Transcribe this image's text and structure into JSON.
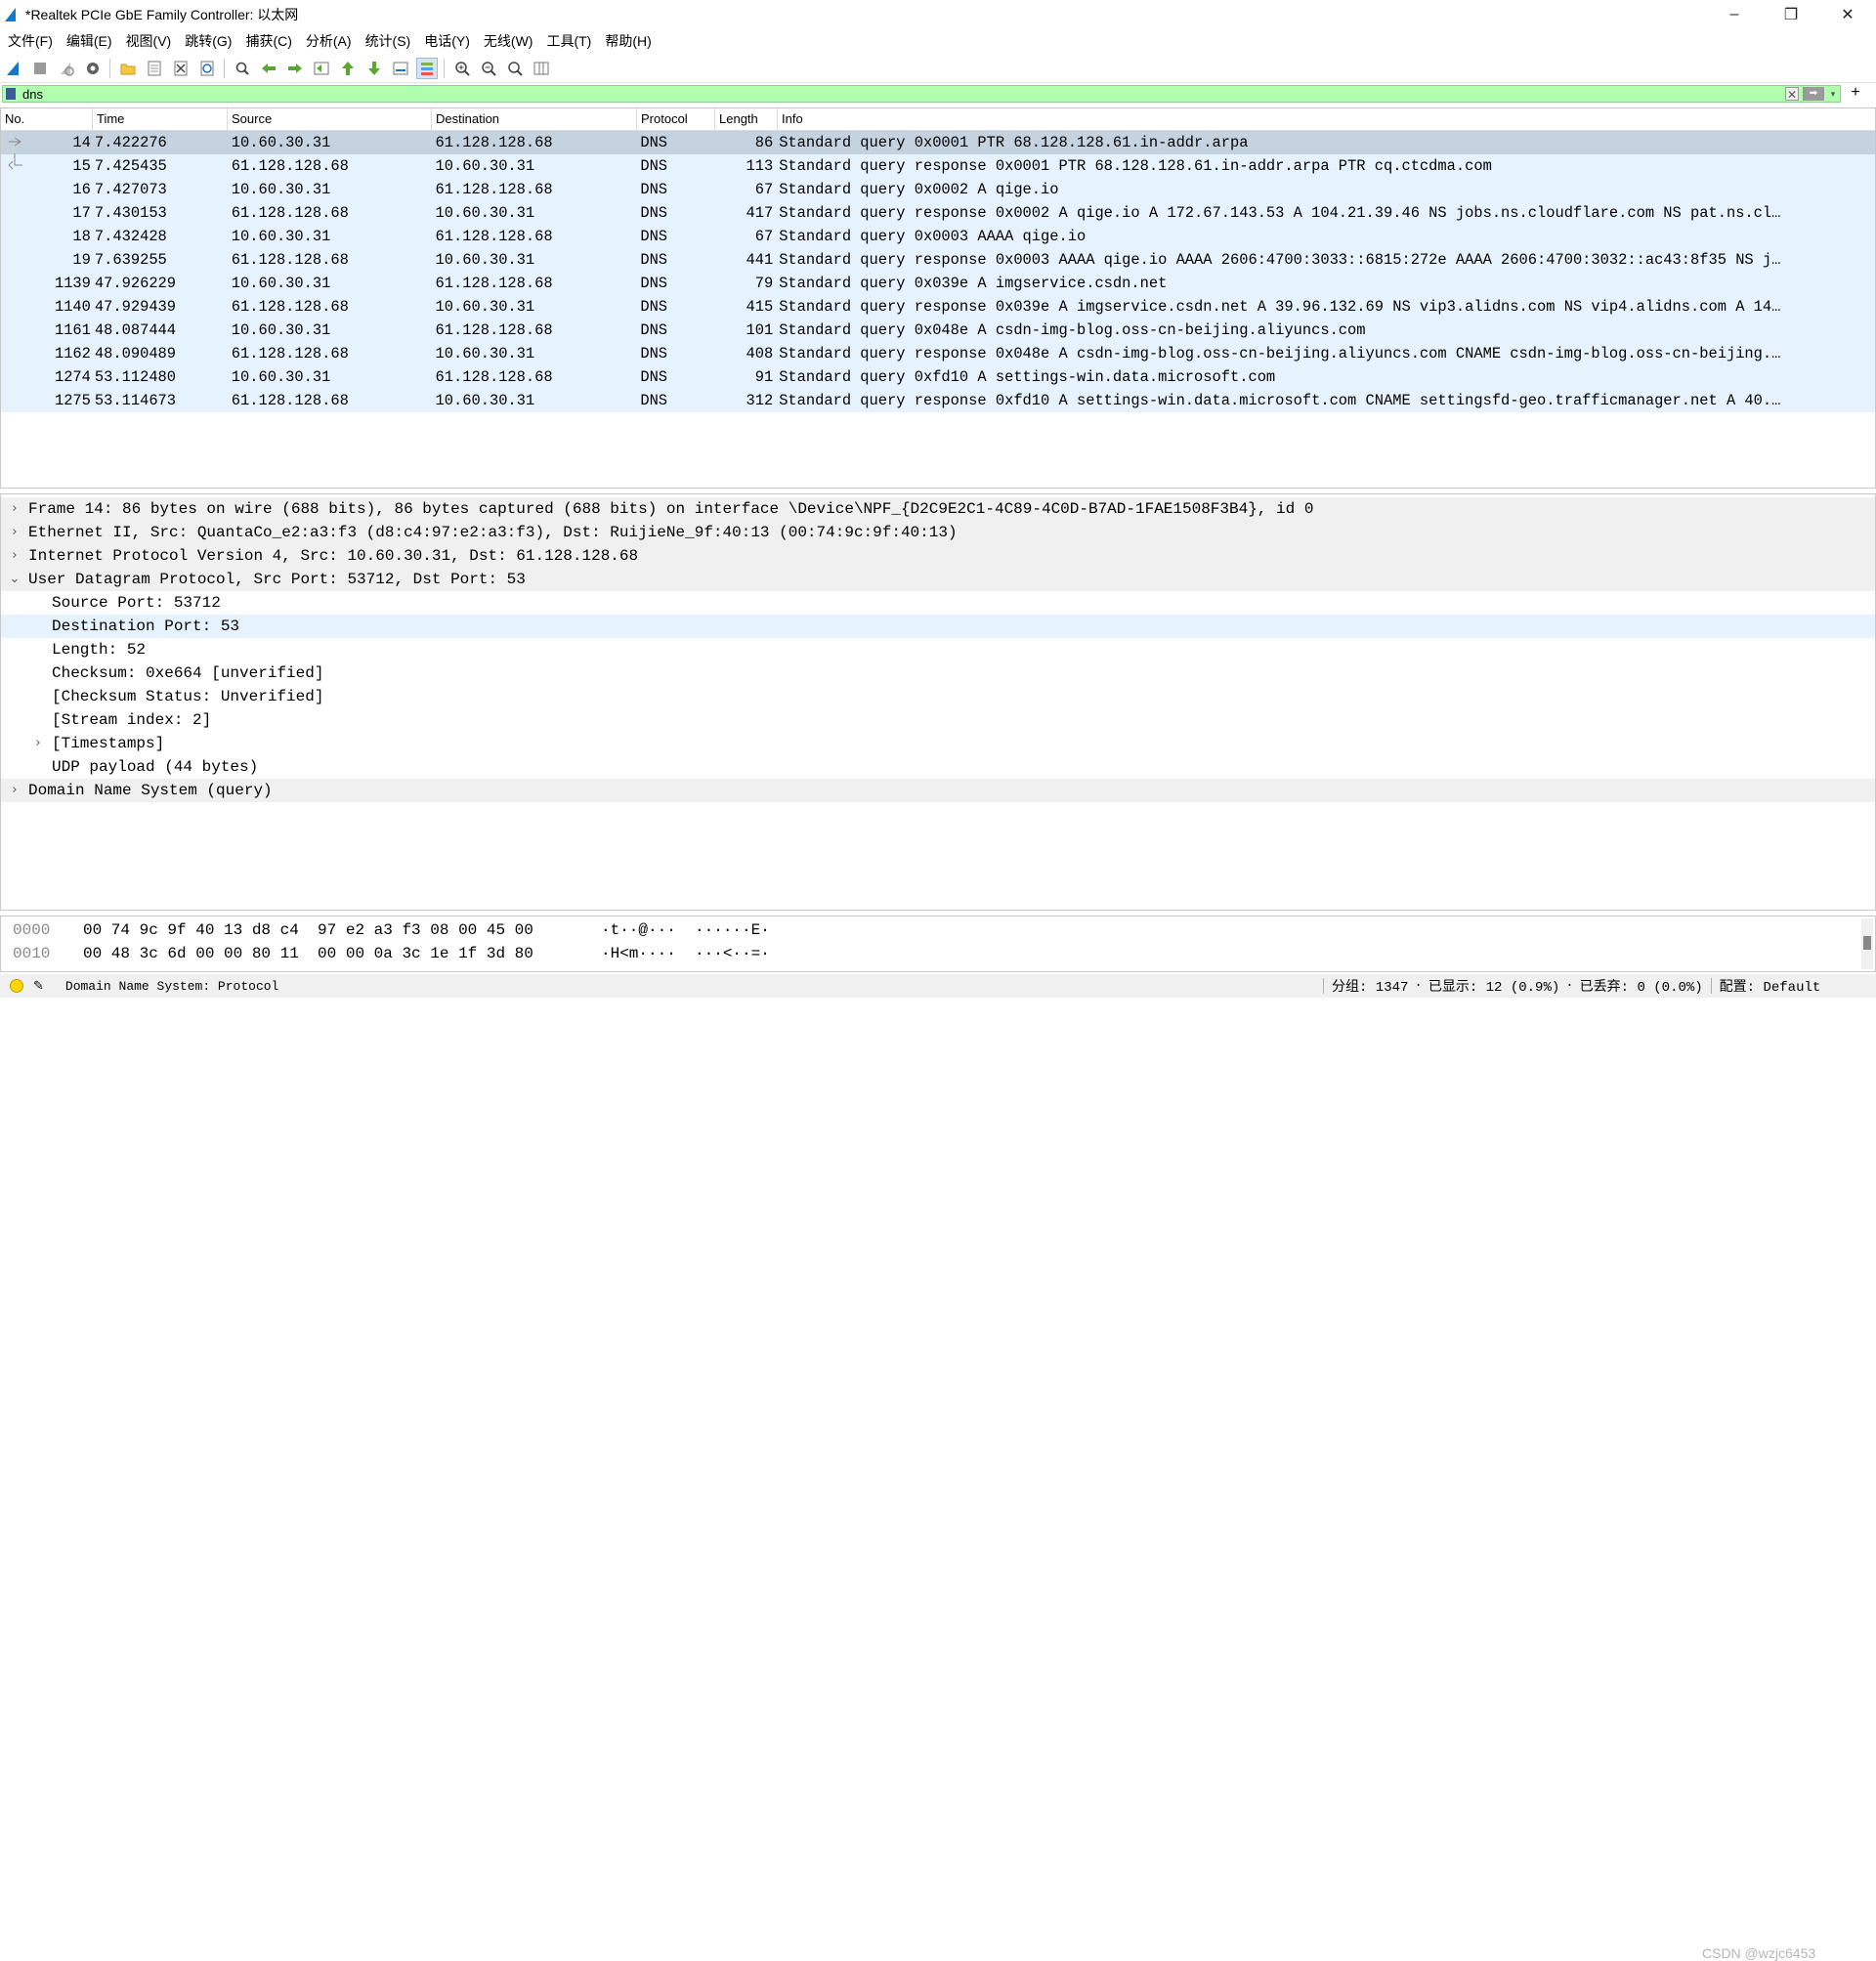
{
  "window": {
    "title": "*Realtek PCIe GbE Family Controller: 以太网",
    "minimize": "–",
    "restore": "❐",
    "close": "✕"
  },
  "menu": [
    "文件(F)",
    "编辑(E)",
    "视图(V)",
    "跳转(G)",
    "捕获(C)",
    "分析(A)",
    "统计(S)",
    "电话(Y)",
    "无线(W)",
    "工具(T)",
    "帮助(H)"
  ],
  "filter": {
    "value": "dns",
    "clear": "✕",
    "apply": "➡",
    "dropdown": "▾",
    "add": "+"
  },
  "packet_list": {
    "headers": {
      "no": "No.",
      "time": "Time",
      "source": "Source",
      "destination": "Destination",
      "protocol": "Protocol",
      "length": "Length",
      "info": "Info"
    },
    "rows": [
      {
        "no": "14",
        "time": "7.422276",
        "source": "10.60.30.31",
        "destination": "61.128.128.68",
        "protocol": "DNS",
        "length": "86",
        "info": "Standard query 0x0001 PTR 68.128.128.61.in-addr.arpa"
      },
      {
        "no": "15",
        "time": "7.425435",
        "source": "61.128.128.68",
        "destination": "10.60.30.31",
        "protocol": "DNS",
        "length": "113",
        "info": "Standard query response 0x0001 PTR 68.128.128.61.in-addr.arpa PTR cq.ctcdma.com"
      },
      {
        "no": "16",
        "time": "7.427073",
        "source": "10.60.30.31",
        "destination": "61.128.128.68",
        "protocol": "DNS",
        "length": "67",
        "info": "Standard query 0x0002 A qige.io"
      },
      {
        "no": "17",
        "time": "7.430153",
        "source": "61.128.128.68",
        "destination": "10.60.30.31",
        "protocol": "DNS",
        "length": "417",
        "info": "Standard query response 0x0002 A qige.io A 172.67.143.53 A 104.21.39.46 NS jobs.ns.cloudflare.com NS pat.ns.cl…"
      },
      {
        "no": "18",
        "time": "7.432428",
        "source": "10.60.30.31",
        "destination": "61.128.128.68",
        "protocol": "DNS",
        "length": "67",
        "info": "Standard query 0x0003 AAAA qige.io"
      },
      {
        "no": "19",
        "time": "7.639255",
        "source": "61.128.128.68",
        "destination": "10.60.30.31",
        "protocol": "DNS",
        "length": "441",
        "info": "Standard query response 0x0003 AAAA qige.io AAAA 2606:4700:3033::6815:272e AAAA 2606:4700:3032::ac43:8f35 NS j…"
      },
      {
        "no": "1139",
        "time": "47.926229",
        "source": "10.60.30.31",
        "destination": "61.128.128.68",
        "protocol": "DNS",
        "length": "79",
        "info": "Standard query 0x039e A imgservice.csdn.net"
      },
      {
        "no": "1140",
        "time": "47.929439",
        "source": "61.128.128.68",
        "destination": "10.60.30.31",
        "protocol": "DNS",
        "length": "415",
        "info": "Standard query response 0x039e A imgservice.csdn.net A 39.96.132.69 NS vip3.alidns.com NS vip4.alidns.com A 14…"
      },
      {
        "no": "1161",
        "time": "48.087444",
        "source": "10.60.30.31",
        "destination": "61.128.128.68",
        "protocol": "DNS",
        "length": "101",
        "info": "Standard query 0x048e A csdn-img-blog.oss-cn-beijing.aliyuncs.com"
      },
      {
        "no": "1162",
        "time": "48.090489",
        "source": "61.128.128.68",
        "destination": "10.60.30.31",
        "protocol": "DNS",
        "length": "408",
        "info": "Standard query response 0x048e A csdn-img-blog.oss-cn-beijing.aliyuncs.com CNAME csdn-img-blog.oss-cn-beijing.…"
      },
      {
        "no": "1274",
        "time": "53.112480",
        "source": "10.60.30.31",
        "destination": "61.128.128.68",
        "protocol": "DNS",
        "length": "91",
        "info": "Standard query 0xfd10 A settings-win.data.microsoft.com"
      },
      {
        "no": "1275",
        "time": "53.114673",
        "source": "61.128.128.68",
        "destination": "10.60.30.31",
        "protocol": "DNS",
        "length": "312",
        "info": "Standard query response 0xfd10 A settings-win.data.microsoft.com CNAME settingsfd-geo.trafficmanager.net A 40.…"
      }
    ]
  },
  "details": [
    {
      "arrow": "›",
      "text": "Frame 14: 86 bytes on wire (688 bits), 86 bytes captured (688 bits) on interface \\Device\\NPF_{D2C9E2C1-4C89-4C0D-B7AD-1FAE1508F3B4}, id 0"
    },
    {
      "arrow": "›",
      "text": "Ethernet II, Src: QuantaCo_e2:a3:f3 (d8:c4:97:e2:a3:f3), Dst: RuijieNe_9f:40:13 (00:74:9c:9f:40:13)"
    },
    {
      "arrow": "›",
      "text": "Internet Protocol Version 4, Src: 10.60.30.31, Dst: 61.128.128.68"
    },
    {
      "arrow": "⌄",
      "text": "User Datagram Protocol, Src Port: 53712, Dst Port: 53"
    },
    {
      "arrow": "",
      "text": "Source Port: 53712"
    },
    {
      "arrow": "",
      "text": "Destination Port: 53"
    },
    {
      "arrow": "",
      "text": "Length: 52"
    },
    {
      "arrow": "",
      "text": "Checksum: 0xe664 [unverified]"
    },
    {
      "arrow": "",
      "text": "[Checksum Status: Unverified]"
    },
    {
      "arrow": "",
      "text": "[Stream index: 2]"
    },
    {
      "arrow": "›",
      "text": "[Timestamps]"
    },
    {
      "arrow": "",
      "text": "UDP payload (44 bytes)"
    },
    {
      "arrow": "›",
      "text": "Domain Name System (query)"
    }
  ],
  "bytes": [
    {
      "offset": "0000",
      "hex": "00 74 9c 9f 40 13 d8 c4  97 e2 a3 f3 08 00 45 00",
      "ascii": "·t··@···  ······E·"
    },
    {
      "offset": "0010",
      "hex": "00 48 3c 6d 00 00 80 11  00 00 0a 3c 1e 1f 3d 80",
      "ascii": "·H<m····  ···<··=·"
    }
  ],
  "status": {
    "field": "Domain Name System: Protocol",
    "packets": "分组: 1347",
    "displayed": "已显示: 12 (0.9%)",
    "dropped": "已丢弃: 0 (0.0%)",
    "profile": "配置: Default",
    "watermark": "CSDN @wzjc6453"
  },
  "colors": {
    "row_bg": "#e6f2fd",
    "selected_row_bg": "#c5d2df",
    "filter_bg": "#afffaf"
  }
}
